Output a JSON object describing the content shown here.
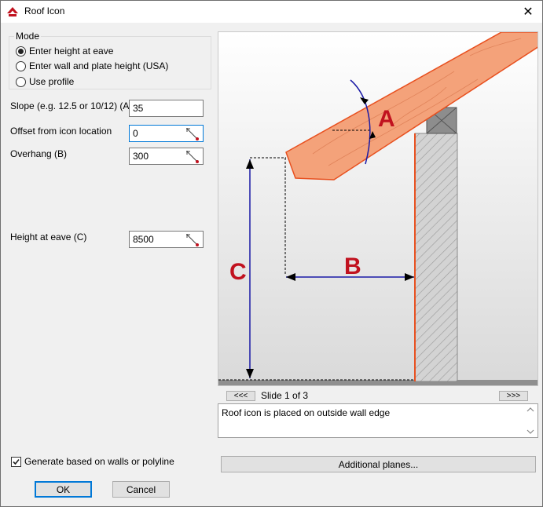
{
  "window": {
    "title": "Roof Icon",
    "close_icon": "close-icon"
  },
  "mode": {
    "legend": "Mode",
    "options": [
      {
        "label": "Enter height at eave",
        "checked": true
      },
      {
        "label": "Enter wall and plate height (USA)",
        "checked": false
      },
      {
        "label": "Use profile",
        "checked": false
      }
    ]
  },
  "fields": {
    "slope": {
      "label": "Slope (e.g. 12.5 or 10/12) (A)",
      "value": "35"
    },
    "offset": {
      "label": "Offset from icon location",
      "value": "0"
    },
    "overhang": {
      "label": "Overhang (B)",
      "value": "300"
    },
    "height": {
      "label": "Height at eave (C)",
      "value": "8500"
    }
  },
  "generate": {
    "label": "Generate based on walls or polyline",
    "checked": true
  },
  "buttons": {
    "ok": "OK",
    "cancel": "Cancel",
    "additional": "Additional planes..."
  },
  "preview": {
    "labels": {
      "a": "A",
      "b": "B",
      "c": "C"
    },
    "prev": "<<<",
    "next": ">>>",
    "slide": "Slide 1 of 3",
    "description": "Roof icon is placed on outside wall edge"
  },
  "colors": {
    "rafter": "#f4a27a",
    "accent_red": "#c1121f",
    "dimension_blue": "#1a1aa6",
    "focus": "#0078d7"
  }
}
